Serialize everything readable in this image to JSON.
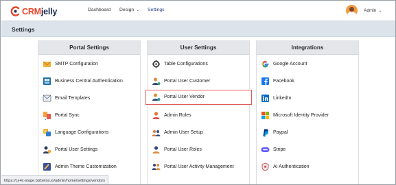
{
  "brand": {
    "crm": "CRM",
    "jelly": "jelly"
  },
  "nav": {
    "dashboard": "Dashboard",
    "design": "Design",
    "settings": "Settings"
  },
  "user": {
    "name": "Admin"
  },
  "page": {
    "title": "Settings"
  },
  "columns": {
    "portal": {
      "title": "Portal Settings",
      "items": [
        {
          "label": "SMTP Configuration",
          "icon": "smtp-mail-icon"
        },
        {
          "label": "Business Central Authentication",
          "icon": "business-central-icon"
        },
        {
          "label": "Email Templates",
          "icon": "email-template-icon"
        },
        {
          "label": "Portal Sync",
          "icon": "portal-sync-icon"
        },
        {
          "label": "Language Configurations",
          "icon": "language-icon"
        },
        {
          "label": "Portal User Settings",
          "icon": "user-settings-icon"
        },
        {
          "label": "Admin Theme Customization",
          "icon": "theme-customization-icon"
        }
      ]
    },
    "user": {
      "title": "User Settings",
      "items": [
        {
          "label": "Table Configurations",
          "icon": "table-config-icon"
        },
        {
          "label": "Portal User Customer",
          "icon": "user-customer-icon"
        },
        {
          "label": "Portal User Vendor",
          "icon": "user-vendor-icon",
          "selected": true
        },
        {
          "label": "Admin Roles",
          "icon": "admin-roles-icon"
        },
        {
          "label": "Admin User Setup",
          "icon": "admin-user-setup-icon"
        },
        {
          "label": "Portal User Roles",
          "icon": "user-roles-icon"
        },
        {
          "label": "Portal User Activity Management",
          "icon": "activity-management-icon"
        }
      ]
    },
    "integrations": {
      "title": "Integrations",
      "items": [
        {
          "label": "Google Account",
          "icon": "google-icon"
        },
        {
          "label": "Facebook",
          "icon": "facebook-icon"
        },
        {
          "label": "LinkedIn",
          "icon": "linkedin-icon"
        },
        {
          "label": "Microsoft Identity Provider",
          "icon": "microsoft-icon"
        },
        {
          "label": "Paypal",
          "icon": "paypal-icon"
        },
        {
          "label": "Stripe",
          "icon": "stripe-icon"
        },
        {
          "label": "AI Authentication",
          "icon": "ai-auth-icon"
        }
      ]
    }
  },
  "status_url": "https://cj-4c-stage.bizbetos.io/admin/home/settings/vendors",
  "colors": {
    "accent": "#1f3b7a",
    "selection_border": "#e05a5a",
    "title_bar": "#dde3ea"
  }
}
